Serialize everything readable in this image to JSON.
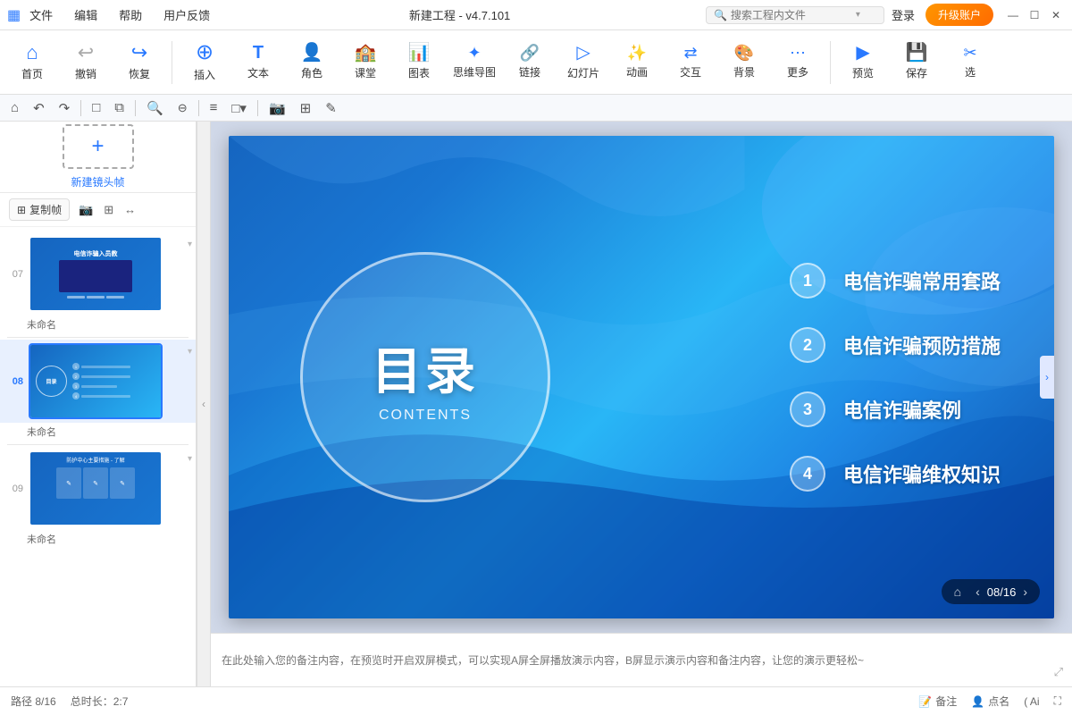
{
  "titleBar": {
    "icon": "▦",
    "menus": [
      "文件",
      "编辑",
      "帮助",
      "用户反馈"
    ],
    "appTitle": "新建工程 - v4.7.101",
    "searchPlaceholder": "搜索工程内文件",
    "loginLabel": "登录",
    "upgradeLabel": "升级账户",
    "winControls": [
      "—",
      "☐",
      "✕"
    ]
  },
  "toolbar": {
    "groups": [
      {
        "icon": "⌂",
        "label": "首页"
      },
      {
        "icon": "↩",
        "label": "撤销"
      },
      {
        "icon": "↪",
        "label": "恢复"
      },
      {
        "icon": "⊕",
        "label": "插入",
        "accent": true
      },
      {
        "icon": "T",
        "label": "文本"
      },
      {
        "icon": "☺",
        "label": "角色"
      },
      {
        "icon": "▦",
        "label": "课堂"
      },
      {
        "icon": "📊",
        "label": "图表"
      },
      {
        "icon": "✦",
        "label": "思维导图"
      },
      {
        "icon": "🔗",
        "label": "链接"
      },
      {
        "icon": "▷",
        "label": "幻灯片"
      },
      {
        "icon": "✨",
        "label": "动画"
      },
      {
        "icon": "⇄",
        "label": "交互"
      },
      {
        "icon": "🖼",
        "label": "背景"
      },
      {
        "icon": "⋯",
        "label": "更多"
      },
      {
        "icon": "▶",
        "label": "预览"
      },
      {
        "icon": "💾",
        "label": "保存"
      },
      {
        "icon": "✂",
        "label": "选"
      }
    ]
  },
  "iconToolbar": {
    "icons": [
      "⌂",
      "↶",
      "↷",
      "□",
      "⧉",
      "🔍+",
      "🔍-",
      "≡",
      "□▿",
      "📷",
      "⊞",
      "✎"
    ]
  },
  "sidebar": {
    "newFrameLabel": "新建镜头帧",
    "copyFrameLabel": "复制帧",
    "tools": [
      "📷",
      "⊞",
      "↔"
    ],
    "slides": [
      {
        "number": "07",
        "label": "未命名",
        "type": "07",
        "active": false
      },
      {
        "number": "08",
        "label": "未命名",
        "type": "08",
        "active": true
      },
      {
        "number": "09",
        "label": "未命名",
        "type": "09",
        "active": false
      }
    ]
  },
  "canvas": {
    "toc": {
      "title": "目录",
      "subtitle": "CONTENTS"
    },
    "items": [
      {
        "number": "1",
        "text": "电信诈骗常用套路"
      },
      {
        "number": "2",
        "text": "电信诈骗预防措施"
      },
      {
        "number": "3",
        "text": "电信诈骗案例"
      },
      {
        "number": "4",
        "text": "电信诈骗维权知识"
      }
    ],
    "navigation": {
      "currentPage": "08",
      "totalPages": "16"
    }
  },
  "notes": {
    "placeholder": "在此处输入您的备注内容，在预览时开启双屏模式，可以实现A屏全屏播放演示内容，B屏显示演示内容和备注内容，让您的演示更轻松~"
  },
  "statusBar": {
    "path": "路径 8/16",
    "duration": "总时长：2:7",
    "noteLabel": "备注",
    "pointLabel": "点名",
    "aiLabel": "( Ai"
  }
}
